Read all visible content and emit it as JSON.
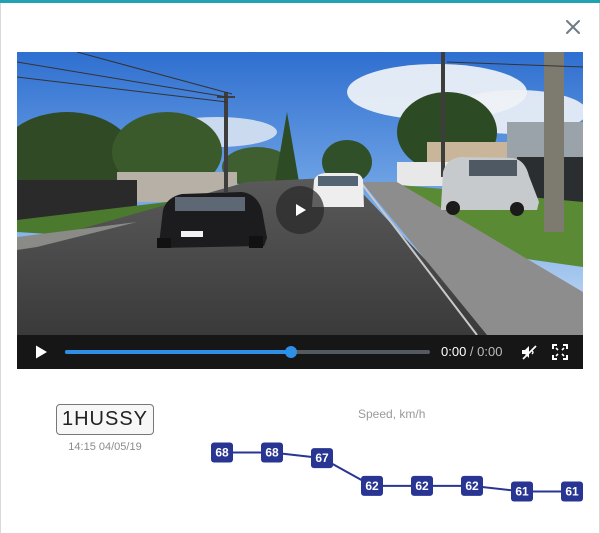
{
  "modal": {
    "accent_color": "#1fa3b0"
  },
  "player": {
    "current_time": "0:00",
    "duration": "0:00",
    "progress": 0.62,
    "time_separator": " / "
  },
  "vehicle": {
    "plate": "1HUSSY",
    "timestamp": "14:15 04/05/19"
  },
  "speed": {
    "label": "Speed, km/h"
  },
  "chart_data": {
    "type": "line",
    "title": "Speed, km/h",
    "x": [
      1,
      2,
      3,
      4,
      5,
      6,
      7,
      8
    ],
    "values": [
      68,
      68,
      67,
      62,
      62,
      62,
      61,
      61
    ],
    "point_labels": [
      "68",
      "68",
      "67",
      "62",
      "62",
      "62",
      "61",
      "61"
    ],
    "ylim": [
      60,
      69
    ],
    "grid": false,
    "axes_visible": false,
    "line_color": "#283593"
  },
  "icons": {
    "close": "close-icon",
    "big_play": "play-icon",
    "play": "play-icon",
    "mute": "mute-icon",
    "fullscreen": "fullscreen-icon"
  }
}
